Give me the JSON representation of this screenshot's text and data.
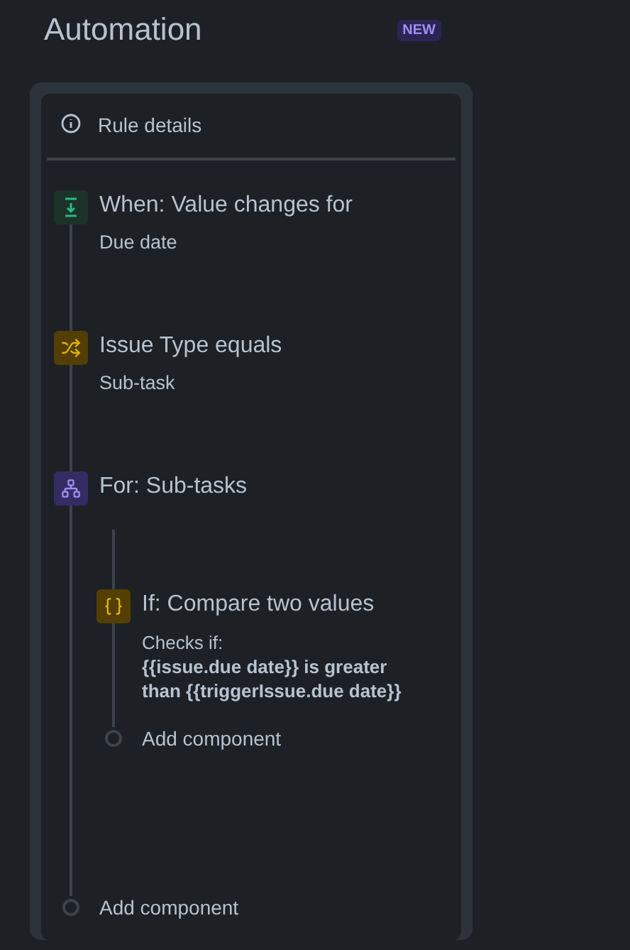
{
  "title": "Automation",
  "badge": "NEW",
  "rule_details": "Rule details",
  "steps": [
    {
      "kind": "trigger",
      "title": "When: Value changes for",
      "subtitle": "Due date"
    },
    {
      "kind": "condition",
      "title": "Issue Type equals",
      "subtitle": "Sub-task"
    },
    {
      "kind": "branch",
      "title": "For: Sub-tasks",
      "children": [
        {
          "kind": "if",
          "title": "If: Compare two values",
          "detail_label": "Checks if:",
          "detail": "{{issue.due date}} is greater than {{triggerIssue.due date}}"
        }
      ],
      "add_component": "Add component"
    }
  ],
  "add_component": "Add component"
}
